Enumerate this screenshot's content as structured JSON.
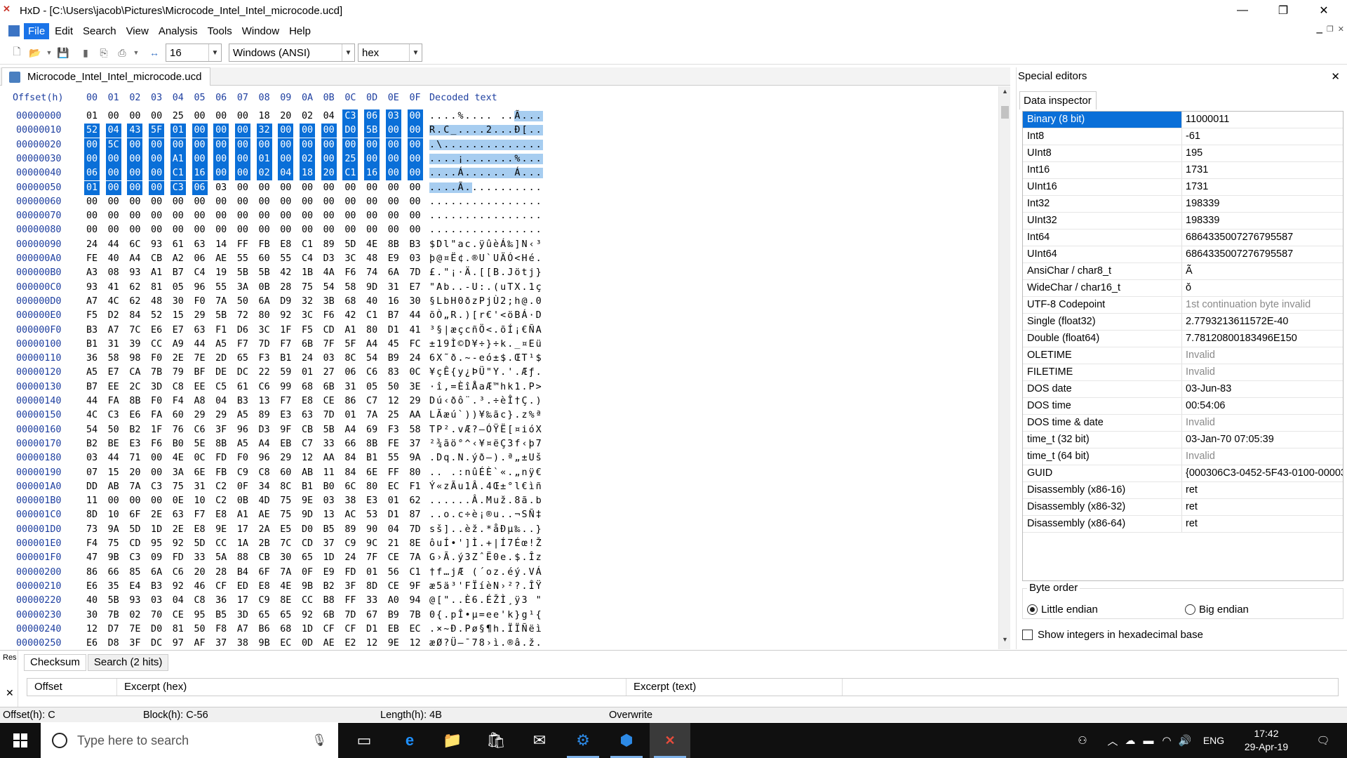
{
  "window": {
    "title": "HxD - [C:\\Users\\jacob\\Pictures\\Microcode_Intel_Intel_microcode.ucd]",
    "minimize": "—",
    "restore": "❐",
    "close": "✕"
  },
  "menu": [
    "File",
    "Edit",
    "Search",
    "View",
    "Analysis",
    "Tools",
    "Window",
    "Help"
  ],
  "toolbar": {
    "bytes_per_row": "16",
    "charset": "Windows (ANSI)",
    "mode": "hex"
  },
  "document_tab": "Microcode_Intel_Intel_microcode.ucd",
  "hex": {
    "header_offset": "Offset(h)",
    "header_cols": [
      "00",
      "01",
      "02",
      "03",
      "04",
      "05",
      "06",
      "07",
      "08",
      "09",
      "0A",
      "0B",
      "0C",
      "0D",
      "0E",
      "0F"
    ],
    "header_decoded": "Decoded text",
    "rows": [
      {
        "o": "00000000",
        "b": "01 00 00 00 25 00 00 00 18 20 02 04 C3 06 03 00",
        "t": "....%.... ..Ã..."
      },
      {
        "o": "00000010",
        "b": "52 04 43 5F 01 00 00 00 32 00 00 00 D0 5B 00 00",
        "t": "R.C_....2...Ð[.."
      },
      {
        "o": "00000020",
        "b": "00 5C 00 00 00 00 00 00 00 00 00 00 00 00 00 00",
        "t": ".\\.............."
      },
      {
        "o": "00000030",
        "b": "00 00 00 00 A1 00 00 00 01 00 02 00 25 00 00 00",
        "t": "....¡.......%..."
      },
      {
        "o": "00000040",
        "b": "06 00 00 00 C1 16 00 00 02 04 18 20 C1 16 00 00",
        "t": "....Á...... Á..."
      },
      {
        "o": "00000050",
        "b": "01 00 00 00 C3 06 03 00 00 00 00 00 00 00 00 00",
        "t": "....Ã..........."
      },
      {
        "o": "00000060",
        "b": "00 00 00 00 00 00 00 00 00 00 00 00 00 00 00 00",
        "t": "................"
      },
      {
        "o": "00000070",
        "b": "00 00 00 00 00 00 00 00 00 00 00 00 00 00 00 00",
        "t": "................"
      },
      {
        "o": "00000080",
        "b": "00 00 00 00 00 00 00 00 00 00 00 00 00 00 00 00",
        "t": "................"
      },
      {
        "o": "00000090",
        "b": "24 44 6C 93 61 63 14 FF FB E8 C1 89 5D 4E 8B B3",
        "t": "$Dl\"ac.ÿûèÁ‰]N‹³"
      },
      {
        "o": "000000A0",
        "b": "FE 40 A4 CB A2 06 AE 55 60 55 C4 D3 3C 48 E9 03",
        "t": "þ@¤Ë¢.®U`UÄÓ<Hé."
      },
      {
        "o": "000000B0",
        "b": "A3 08 93 A1 B7 C4 19 5B 5B 42 1B 4A F6 74 6A 7D",
        "t": "£.\"¡·Ä.[[B.Jötj}"
      },
      {
        "o": "000000C0",
        "b": "93 41 62 81 05 96 55 3A 0B 28 75 54 58 9D 31 E7",
        "t": "\"Ab..-U:.(uTX.1ç"
      },
      {
        "o": "000000D0",
        "b": "A7 4C 62 48 30 F0 7A 50 6A D9 32 3B 68 40 16 30",
        "t": "§LbH0ðzPjÙ2;h@.0"
      },
      {
        "o": "000000E0",
        "b": "F5 D2 84 52 15 29 5B 72 80 92 3C F6 42 C1 B7 44",
        "t": "õÒ„R.)[r€'<öBÁ·D"
      },
      {
        "o": "000000F0",
        "b": "B3 A7 7C E6 E7 63 F1 D6 3C 1F F5 CD A1 80 D1 41",
        "t": "³§|æçcñÖ<.õÍ¡€ÑA"
      },
      {
        "o": "00000100",
        "b": "B1 31 39 CC A9 44 A5 F7 7D F7 6B 7F 5F A4 45 FC",
        "t": "±19Ì©D¥÷}÷k._¤Eü"
      },
      {
        "o": "00000110",
        "b": "36 58 98 F0 2E 7E 2D 65 F3 B1 24 03 8C 54 B9 24",
        "t": "6X˜ð.~-eó±$.ŒT¹$"
      },
      {
        "o": "00000120",
        "b": "A5 E7 CA 7B 79 BF DE DC 22 59 01 27 06 C6 83 0C",
        "t": "¥çÊ{y¿ÞÜ\"Y.'.Æƒ."
      },
      {
        "o": "00000130",
        "b": "B7 EE 2C 3D C8 EE C5 61 C6 99 68 6B 31 05 50 3E",
        "t": "·î,=ÈîÅaÆ™hk1.P>"
      },
      {
        "o": "00000140",
        "b": "44 FA 8B F0 F4 A8 04 B3 13 F7 E8 CE 86 C7 12 29",
        "t": "Dú‹ðô¨.³.÷èÎ†Ç.)"
      },
      {
        "o": "00000150",
        "b": "4C C3 E6 FA 60 29 29 A5 89 E3 63 7D 01 7A 25 AA",
        "t": "LÃæú`))¥‰ãc}.z%ª"
      },
      {
        "o": "00000160",
        "b": "54 50 B2 1F 76 C6 3F 96 D3 9F CB 5B A4 69 F3 58",
        "t": "TP².vÆ?–ÓŸË[¤ióX"
      },
      {
        "o": "00000170",
        "b": "B2 BE E3 F6 B0 5E 8B A5 A4 EB C7 33 66 8B FE 37",
        "t": "²¾ãö°^‹¥¤ëÇ3f‹þ7"
      },
      {
        "o": "00000180",
        "b": "03 44 71 00 4E 0C FD F0 96 29 12 AA 84 B1 55 9A",
        "t": ".Dq.N.ýð–).ª„±Uš"
      },
      {
        "o": "00000190",
        "b": "07 15 20 00 3A 6E FB C9 C8 60 AB 11 84 6E FF 80",
        "t": ".. .:nûÉÈ`«.„nÿ€"
      },
      {
        "o": "000001A0",
        "b": "DD AB 7A C3 75 31 C2 0F 34 8C B1 B0 6C 80 EC F1",
        "t": "Ý«zÃu1Â.4Œ±°l€ìñ"
      },
      {
        "o": "000001B0",
        "b": "11 00 00 00 0E 10 C2 0B 4D 75 9E 03 38 E3 01 62",
        "t": "......Â.Muž.8ã.b"
      },
      {
        "o": "000001C0",
        "b": "8D 10 6F 2E 63 F7 E8 A1 AE 75 9D 13 AC 53 D1 87",
        "t": "..o.c÷è¡®u..¬SÑ‡"
      },
      {
        "o": "000001D0",
        "b": "73 9A 5D 1D 2E E8 9E 17 2A E5 D0 B5 89 90 04 7D",
        "t": "sš]..èž.*åÐµ‰..}"
      },
      {
        "o": "000001E0",
        "b": "F4 75 CD 95 92 5D CC 1A 2B 7C CD 37 C9 9C 21 8E",
        "t": "ôuÍ•']Ì.+|Í7Éœ!Ž"
      },
      {
        "o": "000001F0",
        "b": "47 9B C3 09 FD 33 5A 88 CB 30 65 1D 24 7F CE 7A",
        "t": "G›Ã.ý3ZˆË0e.$.Îz"
      },
      {
        "o": "00000200",
        "b": "86 66 85 6A C6 20 28 B4 6F 7A 0F E9 FD 01 56 C1",
        "t": "†f…jÆ (´oz.éý.VÁ"
      },
      {
        "o": "00000210",
        "b": "E6 35 E4 B3 92 46 CF ED E8 4E 9B B2 3F 8D CE 9F",
        "t": "æ5ä³'FÏíèN›²?.ÎŸ"
      },
      {
        "o": "00000220",
        "b": "40 5B 93 03 04 C8 36 17 C9 8E CC B8 FF 33 A0 94",
        "t": "@[\"..È6.ÉŽÌ¸ÿ3 \""
      },
      {
        "o": "00000230",
        "b": "30 7B 02 70 CE 95 B5 3D 65 65 92 6B 7D 67 B9 7B",
        "t": "0{.pÎ•µ=ee'k}g¹{"
      },
      {
        "o": "00000240",
        "b": "12 D7 7E D0 81 50 F8 A7 B6 68 1D CF CF D1 EB EC",
        "t": ".×~Ð.Pø§¶h.ÏÏÑëì"
      },
      {
        "o": "00000250",
        "b": "E6 D8 3F DC 97 AF 37 38 9B EC 0D AE E2 12 9E 12",
        "t": "æØ?Ü—¯78›ì.®â.ž."
      }
    ]
  },
  "special_editors": {
    "title": "Special editors",
    "tab": "Data inspector",
    "rows": [
      {
        "k": "Binary (8 bit)",
        "v": "11000011"
      },
      {
        "k": "Int8",
        "v": "-61"
      },
      {
        "k": "UInt8",
        "v": "195"
      },
      {
        "k": "Int16",
        "v": "1731"
      },
      {
        "k": "UInt16",
        "v": "1731"
      },
      {
        "k": "Int32",
        "v": "198339"
      },
      {
        "k": "UInt32",
        "v": "198339"
      },
      {
        "k": "Int64",
        "v": "6864335007276795587"
      },
      {
        "k": "UInt64",
        "v": "6864335007276795587"
      },
      {
        "k": "AnsiChar / char8_t",
        "v": "Ã"
      },
      {
        "k": "WideChar / char16_t",
        "v": "ǒ"
      },
      {
        "k": "UTF-8 Codepoint",
        "v": "1st continuation byte invalid"
      },
      {
        "k": "Single (float32)",
        "v": "2.7793213611572E-40"
      },
      {
        "k": "Double (float64)",
        "v": "7.78120800183496E150"
      },
      {
        "k": "OLETIME",
        "v": "Invalid"
      },
      {
        "k": "FILETIME",
        "v": "Invalid"
      },
      {
        "k": "DOS date",
        "v": "03-Jun-83"
      },
      {
        "k": "DOS time",
        "v": "00:54:06"
      },
      {
        "k": "DOS time & date",
        "v": "Invalid"
      },
      {
        "k": "time_t (32 bit)",
        "v": "03-Jan-70 07:05:39"
      },
      {
        "k": "time_t (64 bit)",
        "v": "Invalid"
      },
      {
        "k": "GUID",
        "v": "{000306C3-0452-5F43-0100-00003"
      },
      {
        "k": "Disassembly (x86-16)",
        "v": "ret"
      },
      {
        "k": "Disassembly (x86-32)",
        "v": "ret"
      },
      {
        "k": "Disassembly (x86-64)",
        "v": "ret"
      }
    ],
    "byte_order_label": "Byte order",
    "little_endian": "Little endian",
    "big_endian": "Big endian",
    "hex_checkbox": "Show integers in hexadecimal base"
  },
  "bottom": {
    "side_label": "Res",
    "tabs": [
      "Checksum",
      "Search (2 hits)"
    ],
    "columns": [
      "Offset",
      "Excerpt (hex)",
      "Excerpt (text)"
    ]
  },
  "status": {
    "offset": "Offset(h): C",
    "block": "Block(h): C-56",
    "length": "Length(h): 4B",
    "mode": "Overwrite"
  },
  "taskbar": {
    "search_placeholder": "Type here to search",
    "time": "17:42",
    "date": "29-Apr-19",
    "lang": "ENG"
  }
}
